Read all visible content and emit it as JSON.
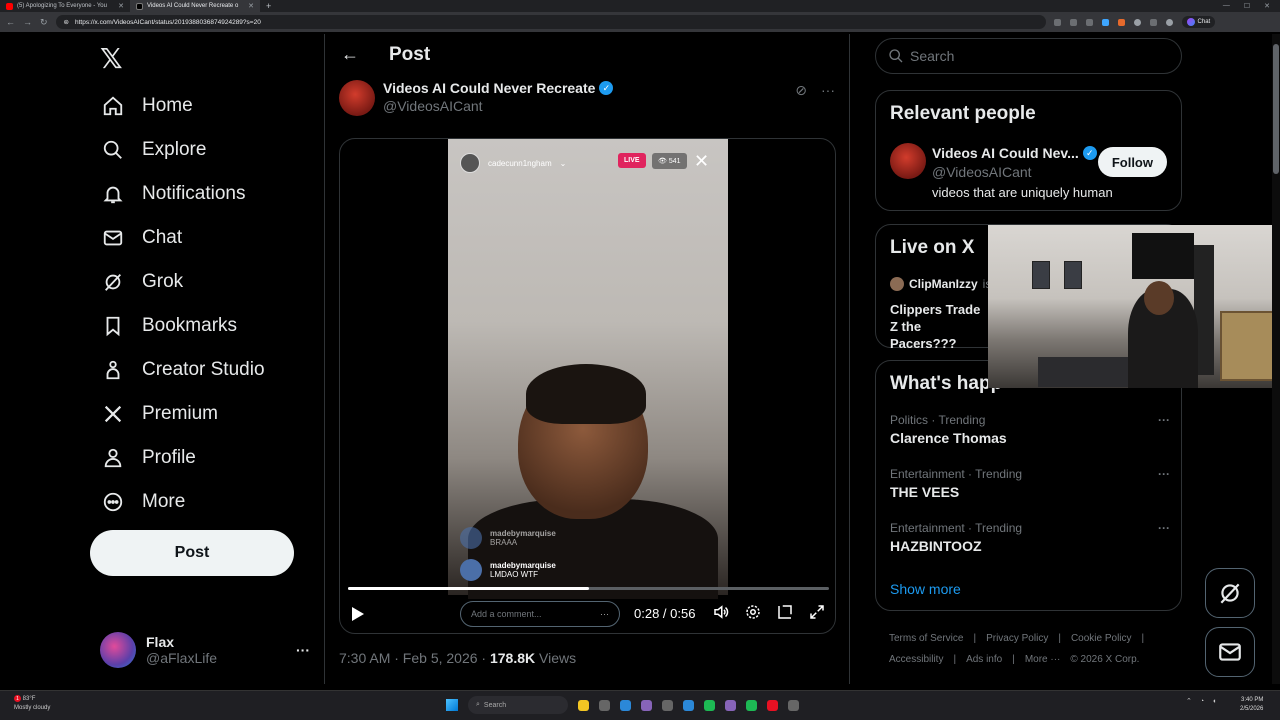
{
  "browser": {
    "tabs": [
      {
        "title": "(5) Apologizing To Everyone - You",
        "active": false,
        "icon": "youtube-icon"
      },
      {
        "title": "Videos AI Could Never Recreate o",
        "active": true,
        "icon": "x-icon"
      }
    ],
    "url": "https://x.com/VideosAICant/status/2019388036874924289?s=20",
    "chat_label": "Chat"
  },
  "nav": {
    "logo": "𝕏",
    "items": [
      {
        "label": "Home",
        "icon": "home-icon"
      },
      {
        "label": "Explore",
        "icon": "search-icon"
      },
      {
        "label": "Notifications",
        "icon": "bell-icon"
      },
      {
        "label": "Chat",
        "icon": "mail-icon"
      },
      {
        "label": "Grok",
        "icon": "grok-icon"
      },
      {
        "label": "Bookmarks",
        "icon": "bookmark-icon"
      },
      {
        "label": "Creator Studio",
        "icon": "creator-icon"
      },
      {
        "label": "Premium",
        "icon": "x-icon"
      },
      {
        "label": "Profile",
        "icon": "person-icon"
      },
      {
        "label": "More",
        "icon": "more-circle-icon"
      }
    ],
    "post_button": "Post",
    "account": {
      "display_name": "Flax",
      "handle": "@aFlaxLife"
    }
  },
  "header": {
    "title": "Post"
  },
  "post": {
    "author_name": "Videos AI Could Never Recreate",
    "author_handle": "@VideosAICant",
    "video": {
      "streamer": "cadecunn1ngham",
      "live_label": "LIVE",
      "viewers": "541",
      "comments": [
        {
          "user": "madebymarquise",
          "text": "BRAAA"
        },
        {
          "user": "madebymarquise",
          "text": "LMDAO WTF"
        }
      ],
      "comment_placeholder": "Add a comment...",
      "current_time": "0:28",
      "duration": "0:56",
      "time_display": "0:28 / 0:56",
      "progress": 0.5
    },
    "timestamp": "7:30 AM · Feb 5, 2026 · ",
    "views_count": "178.8K",
    "views_label": " Views"
  },
  "search": {
    "placeholder": "Search"
  },
  "relevant_people": {
    "title": "Relevant people",
    "name": "Videos AI Could Nev...",
    "handle": "@VideosAICant",
    "bio": "videos that are uniquely human",
    "follow_label": "Follow"
  },
  "live_on_x": {
    "title": "Live on X",
    "host": "ClipManIzzy",
    "host_suffix": " is",
    "topic": "Clippers Trade Z the Pacers???"
  },
  "whats_happening": {
    "title": "What's happ",
    "trends": [
      {
        "category": "Politics · Trending",
        "name": "Clarence Thomas"
      },
      {
        "category": "Entertainment · Trending",
        "name": "THE VEES"
      },
      {
        "category": "Entertainment · Trending",
        "name": "HAZBINTOOZ"
      }
    ],
    "show_more": "Show more"
  },
  "footer": {
    "links": [
      "Terms of Service",
      "|",
      "Privacy Policy",
      "|",
      "Cookie Policy",
      "|",
      "Accessibility",
      "|",
      "Ads info",
      "|",
      "More ···",
      "© 2026 X Corp."
    ]
  },
  "taskbar": {
    "weather_temp": "83°F",
    "weather_desc": "Mostly cloudy",
    "search_label": "Search",
    "time": "3:40 PM",
    "date": "2/5/2026"
  }
}
